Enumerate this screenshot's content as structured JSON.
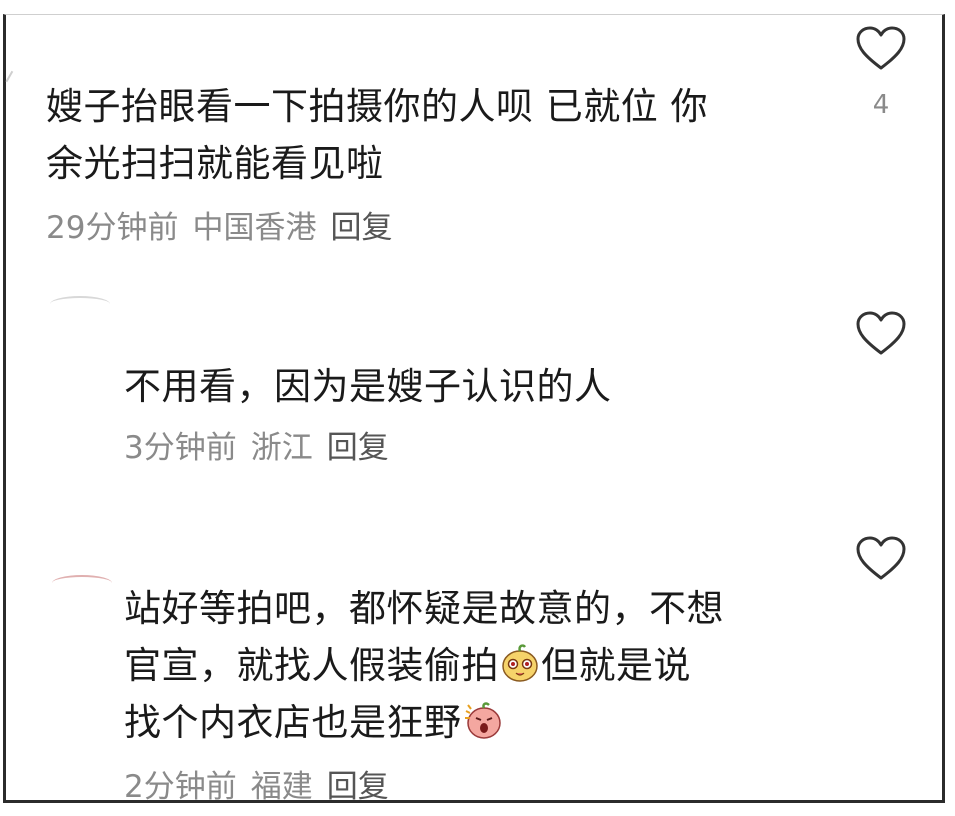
{
  "comments": [
    {
      "text_line1": "嫂子抬眼看一下拍摄你的人呗 已就位 你",
      "text_line2": "余光扫扫就能看见啦",
      "time": "29分钟前",
      "location": "中国香港",
      "reply": "回复",
      "likes": "4"
    },
    {
      "text_line1": "不用看，因为是嫂子认识的人",
      "time": "3分钟前",
      "location": "浙江",
      "reply": "回复"
    },
    {
      "text_line1": "站好等拍吧，都怀疑是故意的，不想",
      "text_line2a": "官宣，就找人假装偷拍",
      "text_line2b": "但就是说",
      "text_line3": "找个内衣店也是狂野",
      "time": "2分钟前",
      "location": "福建",
      "reply": "回复"
    }
  ],
  "icons": [
    "heart-outline-icon",
    "face-emoji-icon",
    "shouting-peach-emoji-icon"
  ],
  "colors": {
    "text": "#1a1a1a",
    "meta": "#8a8a8a",
    "icon": "#333333"
  }
}
